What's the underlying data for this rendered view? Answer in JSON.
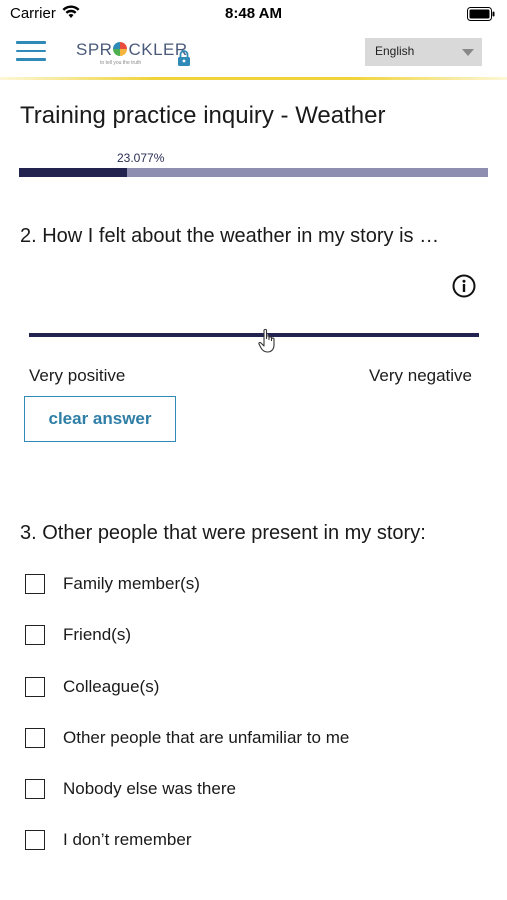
{
  "status_bar": {
    "carrier": "Carrier",
    "time": "8:48 AM"
  },
  "header": {
    "logo_text_left": "SPR",
    "logo_text_right": "CKLER",
    "logo_tagline": "to tell you the truth",
    "language": "English"
  },
  "survey": {
    "title": "Training practice inquiry - Weather",
    "progress_percent": 23.077,
    "progress_label": "23.077%"
  },
  "question2": {
    "text": "2. How I felt about the weather in my story is …",
    "scale_min_label": "Very positive",
    "scale_max_label": "Very negative",
    "clear_label": "clear answer"
  },
  "question3": {
    "text": "3. Other people that were present in my story:",
    "options": [
      "Family member(s)",
      "Friend(s)",
      "Colleague(s)",
      "Other people that are unfamiliar to me",
      "Nobody else was there",
      "I don’t remember"
    ]
  },
  "colors": {
    "accent_blue": "#2f8ab8",
    "progress_dark": "#23234f",
    "progress_light": "#8e8fb0",
    "header_rule": "#f0d43c"
  }
}
